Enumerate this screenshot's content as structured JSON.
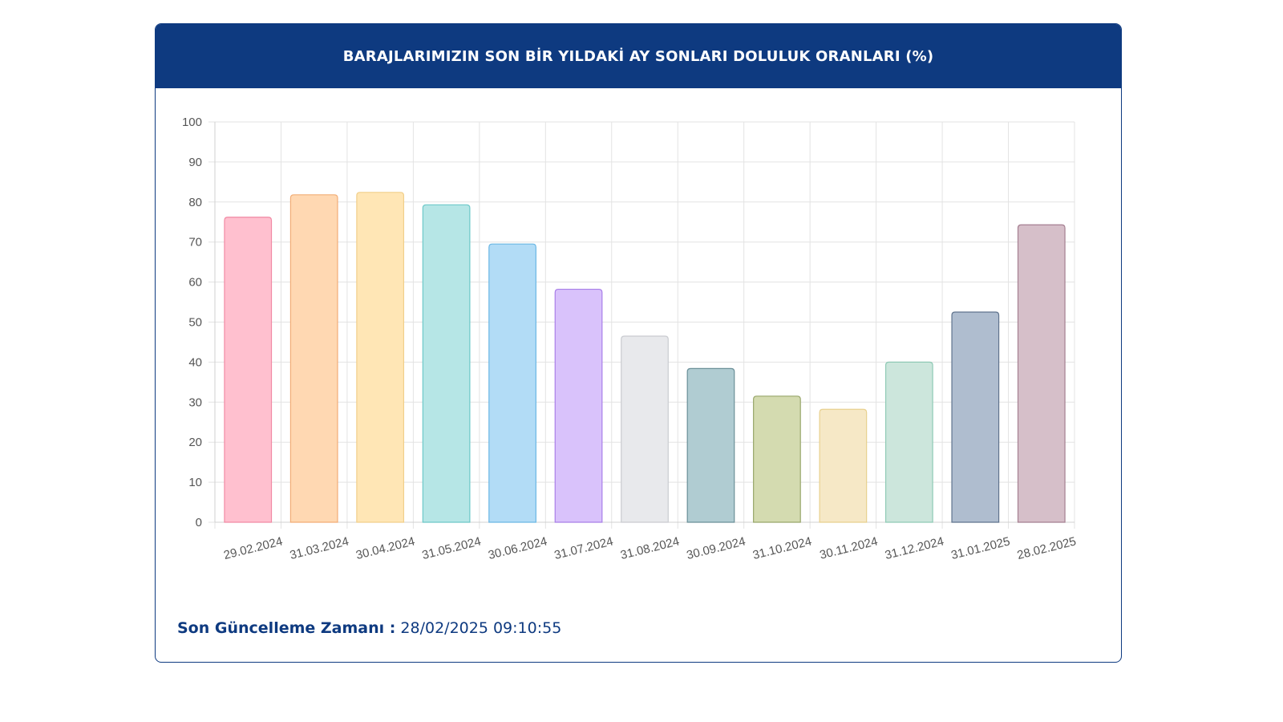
{
  "panel": {
    "title": "BARAJLARIMIZIN SON BİR YILDAKİ AY SONLARI DOLULUK ORANLARI (%)",
    "update_label": "Son Güncelleme Zamanı :",
    "update_value": "28/02/2025 09:10:55"
  },
  "chart_data": {
    "type": "bar",
    "title": "BARAJLARIMIZIN SON BİR YILDAKİ AY SONLARI DOLULUK ORANLARI (%)",
    "xlabel": "",
    "ylabel": "",
    "ylim": [
      0,
      100
    ],
    "yticks": [
      0,
      10,
      20,
      30,
      40,
      50,
      60,
      70,
      80,
      90,
      100
    ],
    "grid": true,
    "legend": "none",
    "categories": [
      "29.02.2024",
      "31.03.2024",
      "30.04.2024",
      "31.05.2024",
      "30.06.2024",
      "31.07.2024",
      "31.08.2024",
      "30.09.2024",
      "31.10.2024",
      "30.11.2024",
      "31.12.2024",
      "31.01.2025",
      "28.02.2025"
    ],
    "values": [
      76.2,
      81.8,
      82.4,
      79.3,
      69.5,
      58.2,
      46.5,
      38.4,
      31.5,
      28.2,
      40.0,
      52.5,
      74.3
    ],
    "fill_colors": [
      "#ffc0cf",
      "#ffd8b2",
      "#ffe6b5",
      "#b6e6e6",
      "#b2dcf6",
      "#d9c2fb",
      "#e8e9ec",
      "#b0ccd2",
      "#d4dbb0",
      "#f6e8c6",
      "#cce6dc",
      "#afbdcf",
      "#d6bfc9"
    ],
    "stroke_colors": [
      "#f08aa4",
      "#f2ad76",
      "#f1cf8a",
      "#6cc8c8",
      "#6bb7e4",
      "#a97fe8",
      "#c9cbd0",
      "#6a8f98",
      "#98a66a",
      "#e8d08e",
      "#8fcab5",
      "#5f738d",
      "#a57f91"
    ]
  }
}
